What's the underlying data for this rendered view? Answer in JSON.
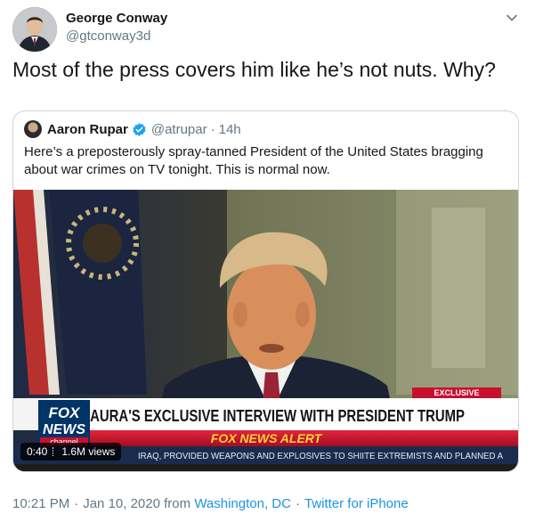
{
  "author": {
    "name": "George Conway",
    "handle": "@gtconway3d"
  },
  "tweet_text": "Most of the press covers him like he’s not nuts.  Why?",
  "quoted_tweet": {
    "author_name": "Aaron Rupar",
    "handle": "@atrupar",
    "separator": "·",
    "time": "14h",
    "text": "Here’s a preposterously spray-tanned President of the United States bragging about war crimes on TV tonight. This is normal now.",
    "video": {
      "duration": "0:40",
      "views": "1.6M views",
      "chyron_main": "LAURA'S EXCLUSIVE INTERVIEW WITH PRESIDENT TRUMP",
      "chyron_tag": "EXCLUSIVE",
      "alert": "FOX NEWS ALERT",
      "ticker": "IRAQ, PROVIDED WEAPONS AND EXPLOSIVES TO SHIITE EXTREMISTS AND PLANNED A",
      "logo_top": "FOX",
      "logo_mid": "NEWS",
      "logo_bottom": "channel"
    }
  },
  "meta": {
    "time": "10:21 PM",
    "dot1": "·",
    "date": "Jan 10, 2020",
    "from": "from",
    "location": "Washington, DC",
    "dot2": "·",
    "source": "Twitter for iPhone"
  },
  "icons": {
    "chevron": "chevron-down-icon",
    "verified": "verified-badge-icon"
  },
  "colors": {
    "link": "#1b95e0",
    "muted": "#657786",
    "border": "#ccd6dd",
    "verified": "#1da1f2",
    "chyron_red": "#c8102e"
  }
}
